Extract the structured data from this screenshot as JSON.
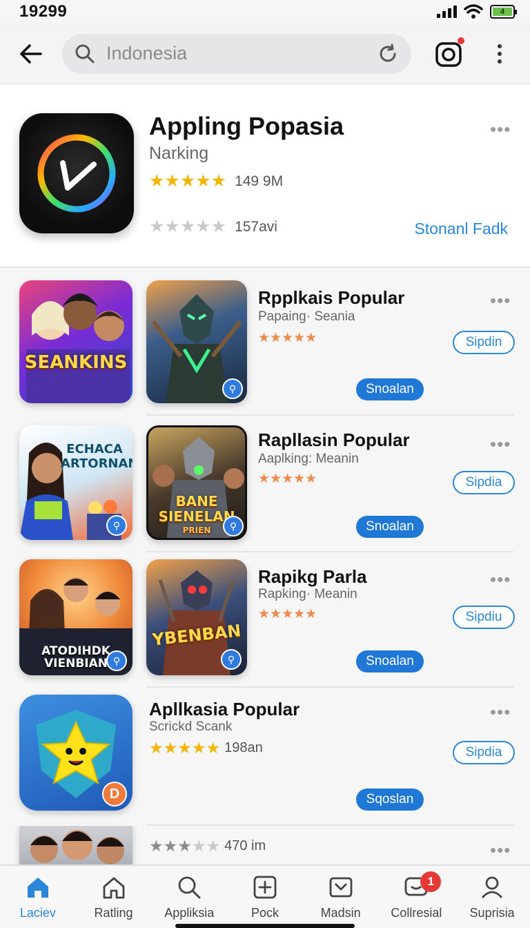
{
  "status_bar": {
    "time": "19299",
    "battery_label": "4"
  },
  "search": {
    "placeholder": "Indonesia"
  },
  "featured": {
    "title": "Appling Popasia",
    "subtitle": "Narking",
    "rating_count": "149 9M",
    "secondary_rating": "157avi",
    "link_label": "Stonanl Fadk"
  },
  "items": [
    {
      "thumb1_label": "SEANKINS",
      "title": "Rpplkais Popular",
      "subtitle": "Papaing· Seania",
      "outline_btn": "Sipdin",
      "solid_btn": "Snoalan"
    },
    {
      "thumb1_label": "ECHACA ARTORNAN",
      "thumb2_label": "BANE SIENELAN",
      "thumb2_sub": "PRIEN",
      "title": "Rapllasin Popular",
      "subtitle": "Aaplking: Meanin",
      "outline_btn": "Sipdia",
      "solid_btn": "Snoalan"
    },
    {
      "thumb1_label": "ATODIHDK VIENBIAN",
      "thumb2_label": "YBENBAN",
      "title": "Rapikg Parla",
      "subtitle": "Rapking· Meanin",
      "outline_btn": "Sipdiu",
      "solid_btn": "Snoalan"
    },
    {
      "thumb_badge": "D",
      "title": "Apllkasia Popular",
      "subtitle": "Scrickd Scank",
      "rating_count": "198an",
      "outline_btn": "Sipdia",
      "solid_btn": "Sqoslan"
    }
  ],
  "partial_item": {
    "rating_count": "470 im"
  },
  "bottom_nav": [
    {
      "label": "Laciev",
      "icon": "home-icon",
      "active": true
    },
    {
      "label": "Ratling",
      "icon": "house-outline-icon"
    },
    {
      "label": "Appliksia",
      "icon": "search-icon"
    },
    {
      "label": "Pock",
      "icon": "plus-box-icon"
    },
    {
      "label": "Madsin",
      "icon": "tray-icon"
    },
    {
      "label": "Collresial",
      "icon": "chat-icon",
      "badge": "1"
    },
    {
      "label": "Suprisia",
      "icon": "person-icon"
    }
  ],
  "colors": {
    "accent": "#2a86d8",
    "star": "#f5b400",
    "star_orange": "#f08a4b",
    "badge_red": "#e53935"
  }
}
